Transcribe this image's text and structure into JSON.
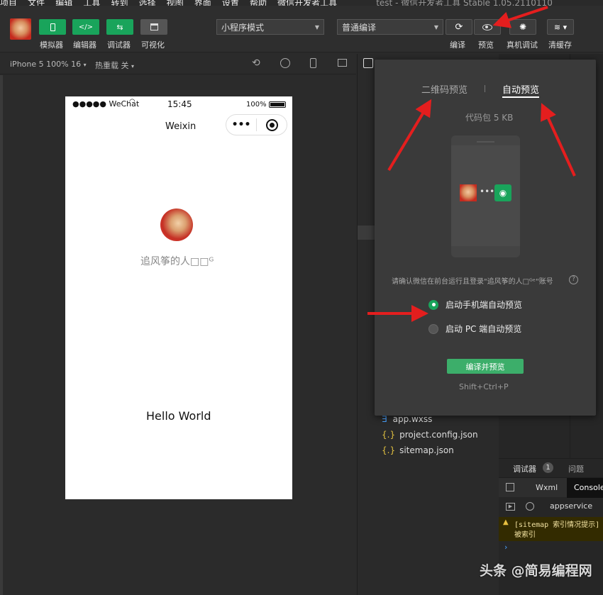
{
  "menubar": [
    "项目",
    "文件",
    "编辑",
    "工具",
    "转到",
    "选择",
    "视图",
    "界面",
    "设置",
    "帮助",
    "微信开发者工具"
  ],
  "window_title": "test - 微信开发者工具 Stable 1.05.2110110",
  "toolbar": {
    "simulator": "模拟器",
    "editor": "编辑器",
    "debugger": "调试器",
    "visualize": "可视化",
    "mode_select": "小程序模式",
    "compile_select": "普通编译",
    "compile": "编译",
    "preview": "预览",
    "remote_debug": "真机调试",
    "clear_cache": "清缓存"
  },
  "simbar": {
    "device": "iPhone 5 100% 16",
    "hot_reload": "热重载 关"
  },
  "phone": {
    "carrier": "●●●●● WeChat",
    "time": "15:45",
    "battery": "100%",
    "nav_title": "Weixin",
    "nickname": "追风筝的人□□ᴳ",
    "hello": "Hello World"
  },
  "popup": {
    "tab_qrcode": "二维码预览",
    "tab_auto": "自动预览",
    "package_size": "代码包 5 KB",
    "confirm_text": "请确认微信在前台运行且登录\"追风筝的人□ᴳᵉ\"账号",
    "option_phone": "启动手机端自动预览",
    "option_pc": "启动 PC 端自动预览",
    "compile_preview_btn": "编译并预览",
    "shortcut": "Shift+Ctrl+P"
  },
  "files": [
    "app.wxss",
    "project.config.json",
    "sitemap.json"
  ],
  "debug": {
    "tab_debugger": "调试器",
    "badge": "1",
    "tab_issues": "问题",
    "tab_wxml": "Wxml",
    "tab_console": "Console",
    "context": "appservice",
    "warning": "[sitemap 索引情况提示]",
    "warning2": "被索引"
  },
  "watermark": "头条 @简易编程网",
  "colors": {
    "green": "#19a45b",
    "red_arrow": "#e41e1e",
    "popup_bg": "#3a3a3a"
  }
}
